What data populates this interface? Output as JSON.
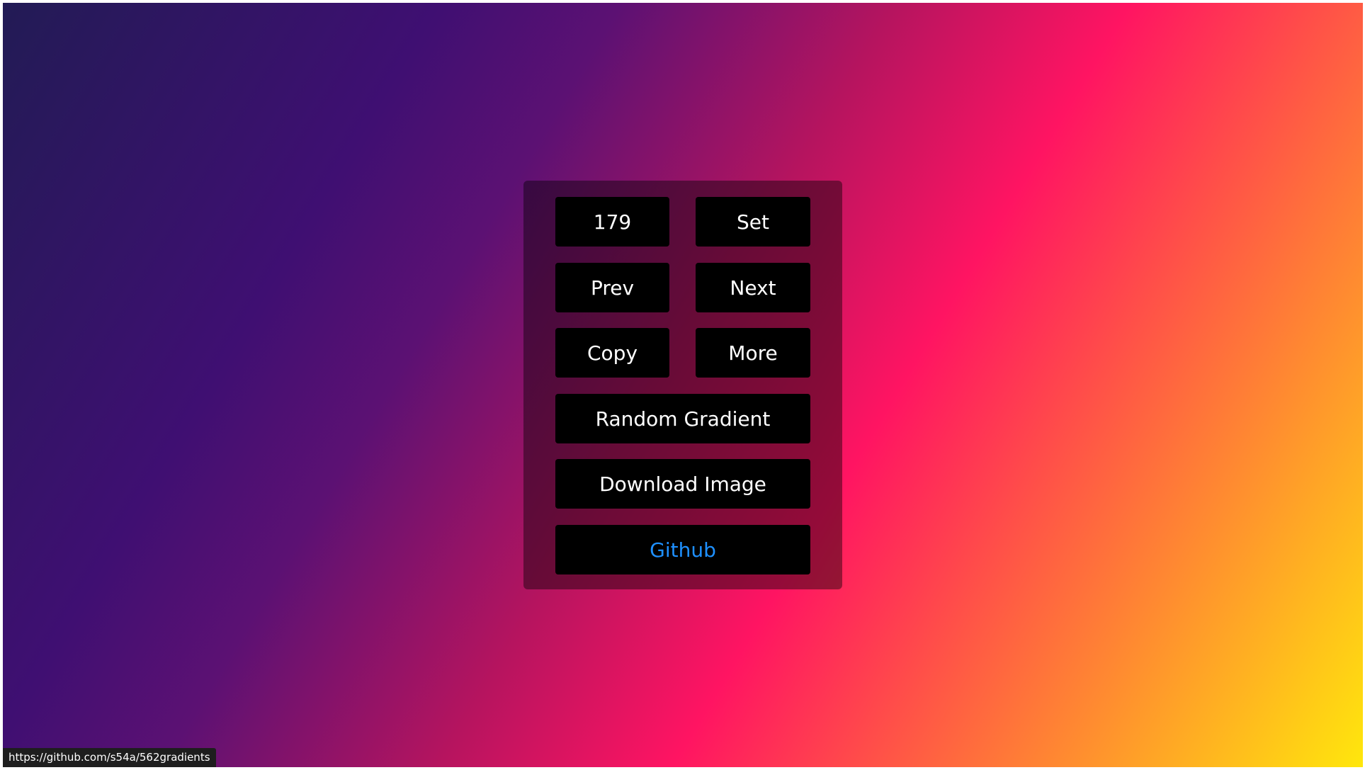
{
  "gradient": {
    "colors": [
      "#221b55",
      "#3f0f72",
      "#b5145f",
      "#ff1462",
      "#ff8e2f",
      "#ffe70c"
    ]
  },
  "controls": {
    "gradient_number": "179",
    "set_label": "Set",
    "prev_label": "Prev",
    "next_label": "Next",
    "copy_label": "Copy",
    "more_label": "More",
    "random_label": "Random Gradient",
    "download_label": "Download Image",
    "github_label": "Github"
  },
  "status": {
    "url": "https://github.com/s54a/562gradients"
  },
  "accent_colors": {
    "button_bg": "#000000",
    "button_text": "#ffffff",
    "link_text": "#1e90ff"
  }
}
